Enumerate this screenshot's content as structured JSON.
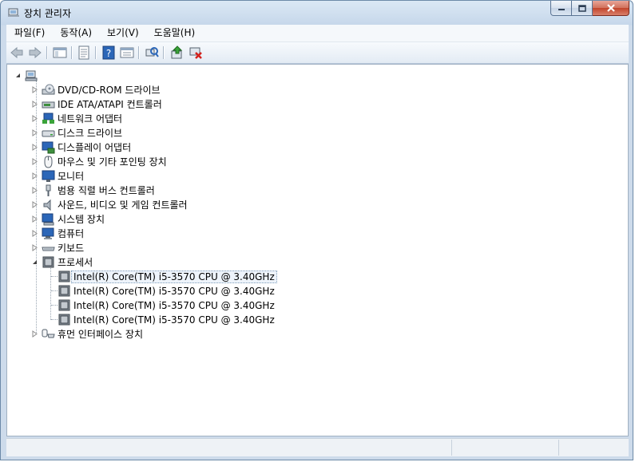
{
  "window": {
    "title": "장치 관리자"
  },
  "menu": [
    "파일(F)",
    "동작(A)",
    "보기(V)",
    "도움말(H)"
  ],
  "toolbar": {
    "buttons": [
      "back-icon",
      "forward-icon",
      "show-hide-console-tree-icon",
      "properties-icon",
      "help-icon",
      "view-icon",
      "scan-hardware-icon",
      "update-driver-icon",
      "uninstall-icon"
    ]
  },
  "tree": {
    "root": {
      "label": ""
    },
    "categories": [
      {
        "label": "DVD/CD-ROM 드라이브",
        "icon": "dvd-drive-icon"
      },
      {
        "label": "IDE ATA/ATAPI 컨트롤러",
        "icon": "ide-controller-icon"
      },
      {
        "label": "네트워크 어댑터",
        "icon": "network-adapter-icon"
      },
      {
        "label": "디스크 드라이브",
        "icon": "disk-drive-icon"
      },
      {
        "label": "디스플레이 어댑터",
        "icon": "display-adapter-icon"
      },
      {
        "label": "마우스 및 기타 포인팅 장치",
        "icon": "mouse-icon"
      },
      {
        "label": "모니터",
        "icon": "monitor-icon"
      },
      {
        "label": "범용 직렬 버스 컨트롤러",
        "icon": "usb-controller-icon"
      },
      {
        "label": "사운드, 비디오 및 게임 컨트롤러",
        "icon": "sound-icon"
      },
      {
        "label": "시스템 장치",
        "icon": "system-device-icon"
      },
      {
        "label": "컴퓨터",
        "icon": "computer-icon"
      },
      {
        "label": "키보드",
        "icon": "keyboard-icon"
      },
      {
        "label": "프로세서",
        "icon": "processor-icon",
        "expanded": true
      }
    ],
    "processors": [
      "Intel(R) Core(TM) i5-3570 CPU @ 3.40GHz",
      "Intel(R) Core(TM) i5-3570 CPU @ 3.40GHz",
      "Intel(R) Core(TM) i5-3570 CPU @ 3.40GHz",
      "Intel(R) Core(TM) i5-3570 CPU @ 3.40GHz"
    ],
    "last_category": {
      "label": "휴먼 인터페이스 장치",
      "icon": "hid-icon"
    }
  },
  "colors": {
    "selection_border": "#7f9db9",
    "title_bg": "#c6d7ea",
    "close_button": "#c2442b"
  }
}
